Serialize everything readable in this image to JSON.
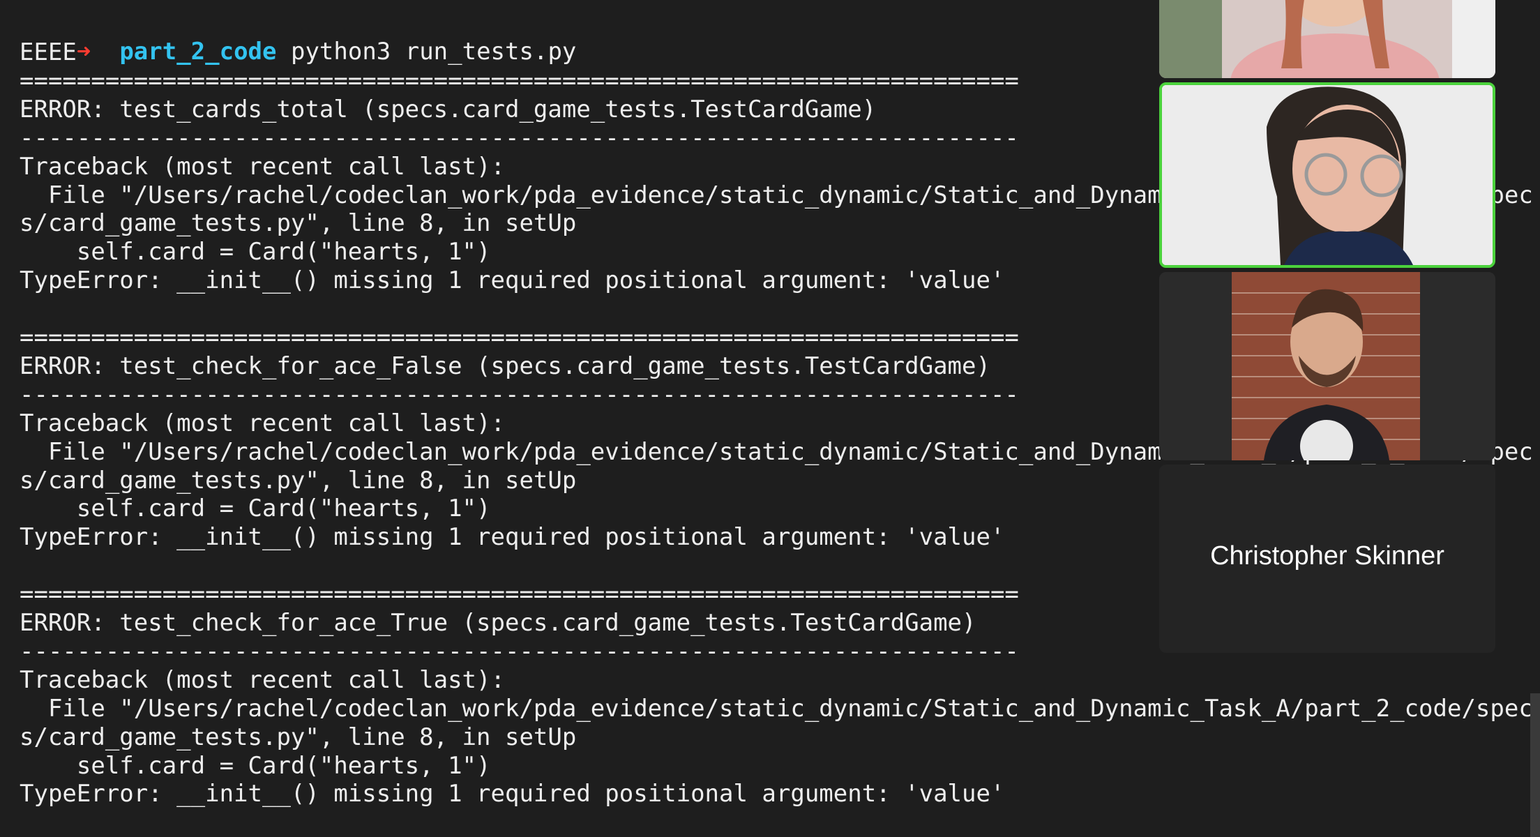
{
  "prompt": {
    "arrow": "➜",
    "directory": "part_2_code",
    "command": "python3 run_tests.py"
  },
  "output_lines": [
    "EEEE",
    "======================================================================",
    "ERROR: test_cards_total (specs.card_game_tests.TestCardGame)",
    "----------------------------------------------------------------------",
    "Traceback (most recent call last):",
    "  File \"/Users/rachel/codeclan_work/pda_evidence/static_dynamic/Static_and_Dynamic_Task_A/part_2_code/spec",
    "s/card_game_tests.py\", line 8, in setUp",
    "    self.card = Card(\"hearts, 1\")",
    "TypeError: __init__() missing 1 required positional argument: 'value'",
    "",
    "======================================================================",
    "ERROR: test_check_for_ace_False (specs.card_game_tests.TestCardGame)",
    "----------------------------------------------------------------------",
    "Traceback (most recent call last):",
    "  File \"/Users/rachel/codeclan_work/pda_evidence/static_dynamic/Static_and_Dynamic_Task_A/part_2_code/spec",
    "s/card_game_tests.py\", line 8, in setUp",
    "    self.card = Card(\"hearts, 1\")",
    "TypeError: __init__() missing 1 required positional argument: 'value'",
    "",
    "======================================================================",
    "ERROR: test_check_for_ace_True (specs.card_game_tests.TestCardGame)",
    "----------------------------------------------------------------------",
    "Traceback (most recent call last):",
    "  File \"/Users/rachel/codeclan_work/pda_evidence/static_dynamic/Static_and_Dynamic_Task_A/part_2_code/spec",
    "s/card_game_tests.py\", line 8, in setUp",
    "    self.card = Card(\"hearts, 1\")",
    "TypeError: __init__() missing 1 required positional argument: 'value'"
  ],
  "video_gallery": {
    "participants": [
      {
        "name": "",
        "video": "on",
        "active_speaker": false
      },
      {
        "name": "",
        "video": "on",
        "active_speaker": true
      },
      {
        "name": "",
        "video": "on",
        "active_speaker": false
      },
      {
        "name": "Christopher Skinner",
        "video": "off",
        "active_speaker": false
      }
    ],
    "active_speaker_color": "#4bd23c"
  },
  "colors": {
    "terminal_background": "#1e1e1e",
    "text": "#eeeeee",
    "prompt_arrow": "#ff3b30",
    "prompt_directory": "#33c3f0"
  }
}
